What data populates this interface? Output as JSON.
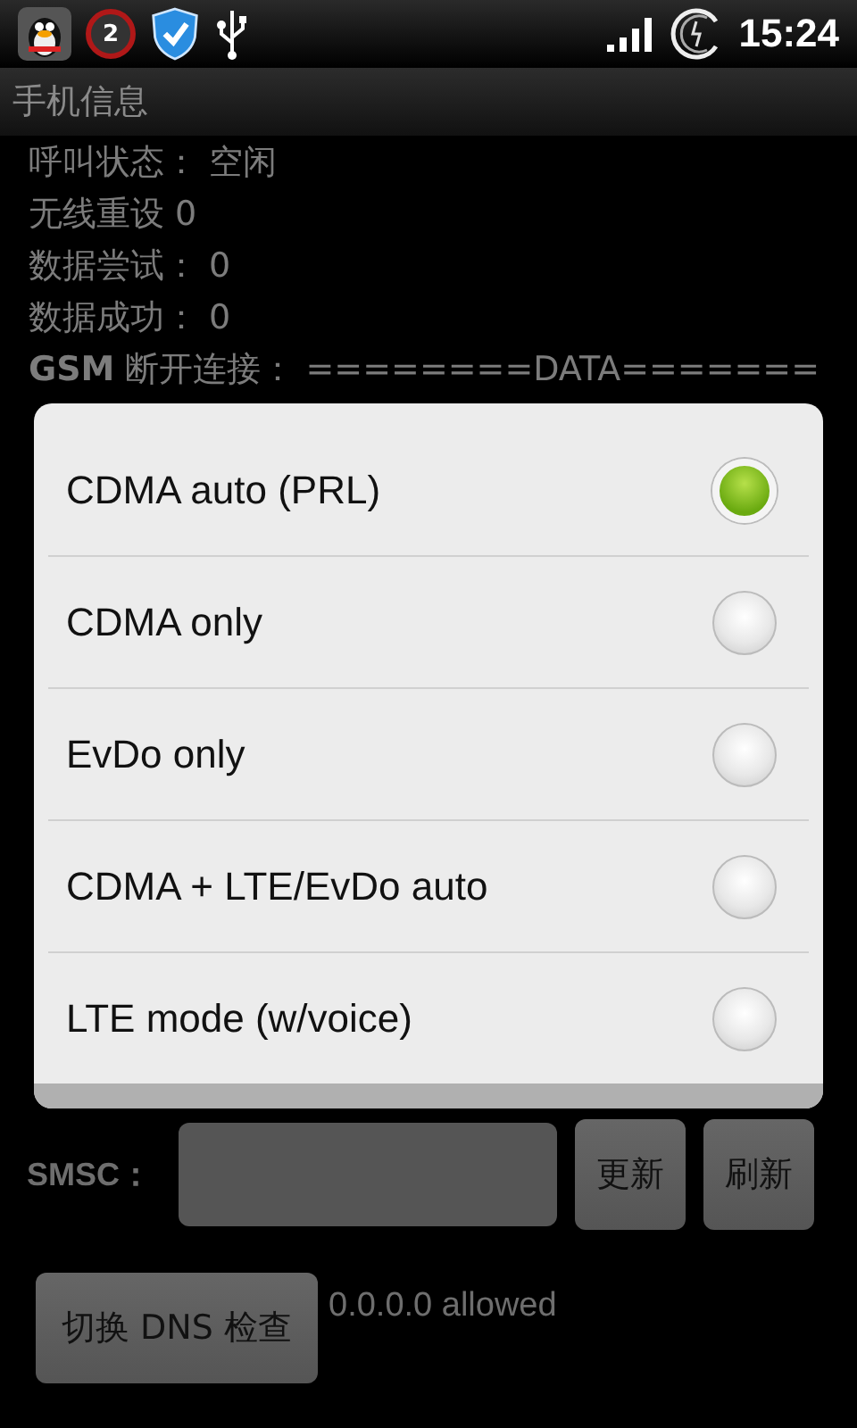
{
  "status_bar": {
    "alarm_count": "2",
    "time": "15:24"
  },
  "title_bar": {
    "title": "手机信息"
  },
  "info_lines": [
    "呼叫状态： 空闲",
    "无线重设 0",
    "数据尝试： 0",
    "数据成功： 0",
    "**GSM** 断开连接： ========DATA======="
  ],
  "smsc": {
    "label": "SMSC：",
    "buttons": [
      "更新",
      "刷新"
    ]
  },
  "dns": {
    "button": "切换 DNS 检查",
    "status": "0.0.0.0 allowed"
  },
  "dialog": {
    "options": [
      {
        "label": "CDMA auto (PRL)",
        "selected": true
      },
      {
        "label": "CDMA only",
        "selected": false
      },
      {
        "label": "EvDo only",
        "selected": false
      },
      {
        "label": "CDMA + LTE/EvDo auto",
        "selected": false
      },
      {
        "label": "LTE mode (w/voice)",
        "selected": false
      }
    ]
  }
}
